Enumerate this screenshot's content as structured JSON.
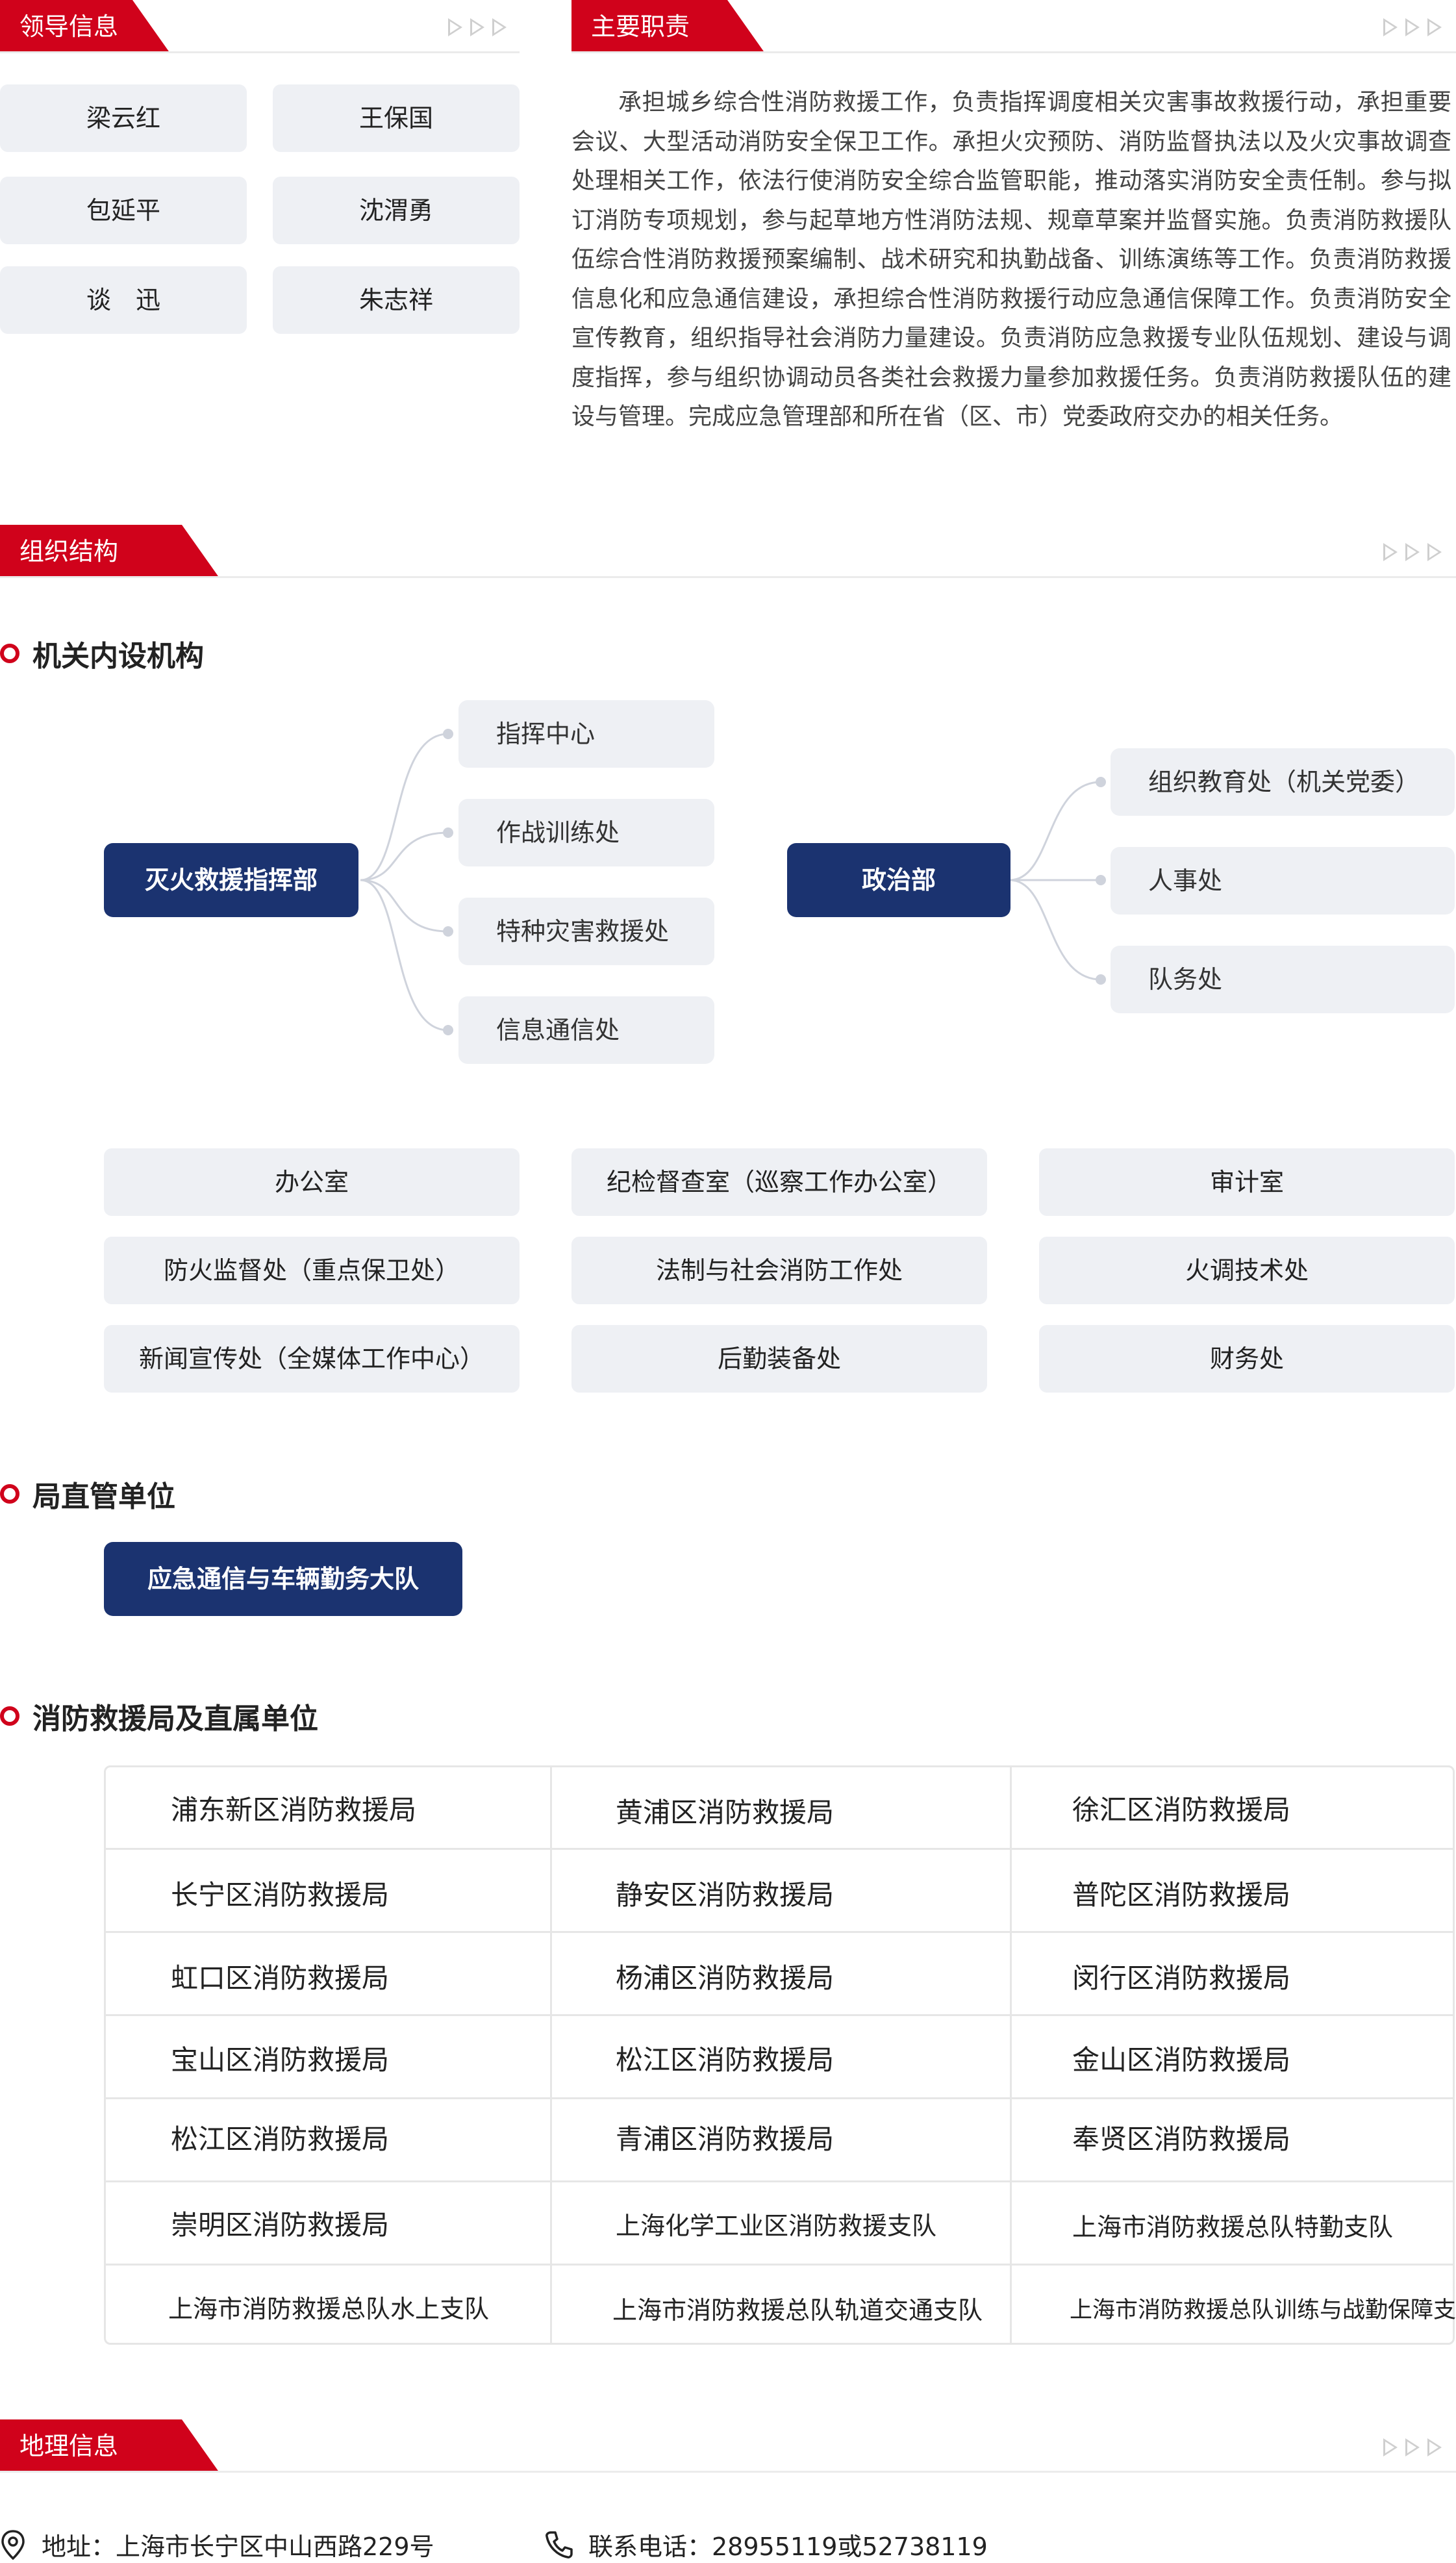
{
  "tabs": {
    "leaders": "领导信息",
    "duties": "主要职责",
    "org": "组织结构",
    "geo": "地理信息"
  },
  "leaders": [
    "梁云红",
    "王保国",
    "包延平",
    "沈渭勇",
    "谈　迅",
    "朱志祥"
  ],
  "duties_text": "承担城乡综合性消防救援工作，负责指挥调度相关灾害事故救援行动，承担重要会议、大型活动消防安全保卫工作。承担火灾预防、消防监督执法以及火灾事故调查处理相关工作，依法行使消防安全综合监管职能，推动落实消防安全责任制。参与拟订消防专项规划，参与起草地方性消防法规、规章草案并监督实施。负责消防救援队伍综合性消防救援预案编制、战术研究和执勤战备、训练演练等工作。负责消防救援信息化和应急通信建设，承担综合性消防救援行动应急通信保障工作。负责消防安全宣传教育，组织指导社会消防力量建设。负责消防应急救援专业队伍规划、建设与调度指挥，参与组织协调动员各类社会救援力量参加救援任务。负责消防救援队伍的建设与管理。完成应急管理部和所在省（区、市）党委政府交办的相关任务。",
  "sections": {
    "internal": "机关内设机构",
    "direct": "局直管单位",
    "bureaus": "消防救援局及直属单位"
  },
  "tree": {
    "left_main": "灭火救援指挥部",
    "left_children": [
      "指挥中心",
      "作战训练处",
      "特种灾害救援处",
      "信息通信处"
    ],
    "right_main": "政治部",
    "right_children": [
      "组织教育处（机关党委）",
      "人事处",
      "队务处"
    ]
  },
  "offices": [
    [
      "办公室",
      "纪检督查室（巡察工作办公室）",
      "审计室"
    ],
    [
      "防火监督处（重点保卫处）",
      "法制与社会消防工作处",
      "火调技术处"
    ],
    [
      "新闻宣传处（全媒体工作中心）",
      "后勤装备处",
      "财务处"
    ]
  ],
  "direct_unit": "应急通信与车辆勤务大队",
  "bureaus": [
    [
      "浦东新区消防救援局",
      "黄浦区消防救援局",
      "徐汇区消防救援局"
    ],
    [
      "长宁区消防救援局",
      "静安区消防救援局",
      "普陀区消防救援局"
    ],
    [
      "虹口区消防救援局",
      "杨浦区消防救援局",
      "闵行区消防救援局"
    ],
    [
      "宝山区消防救援局",
      "松江区消防救援局",
      "金山区消防救援局"
    ],
    [
      "松江区消防救援局",
      "青浦区消防救援局",
      "奉贤区消防救援局"
    ],
    [
      "崇明区消防救援局",
      "上海化学工业区消防救援支队",
      "上海市消防救援总队特勤支队"
    ],
    [
      "上海市消防救援总队水上支队",
      "上海市消防救援总队轨道交通支队",
      "上海市消防救援总队训练与战勤保障支队"
    ]
  ],
  "footer": {
    "address": "地址：上海市长宁区中山西路229号",
    "phone": "联系电话：28955119或52738119"
  },
  "colors": {
    "accent": "#d0021b",
    "navy": "#1b3370",
    "card": "#eef0f4"
  }
}
